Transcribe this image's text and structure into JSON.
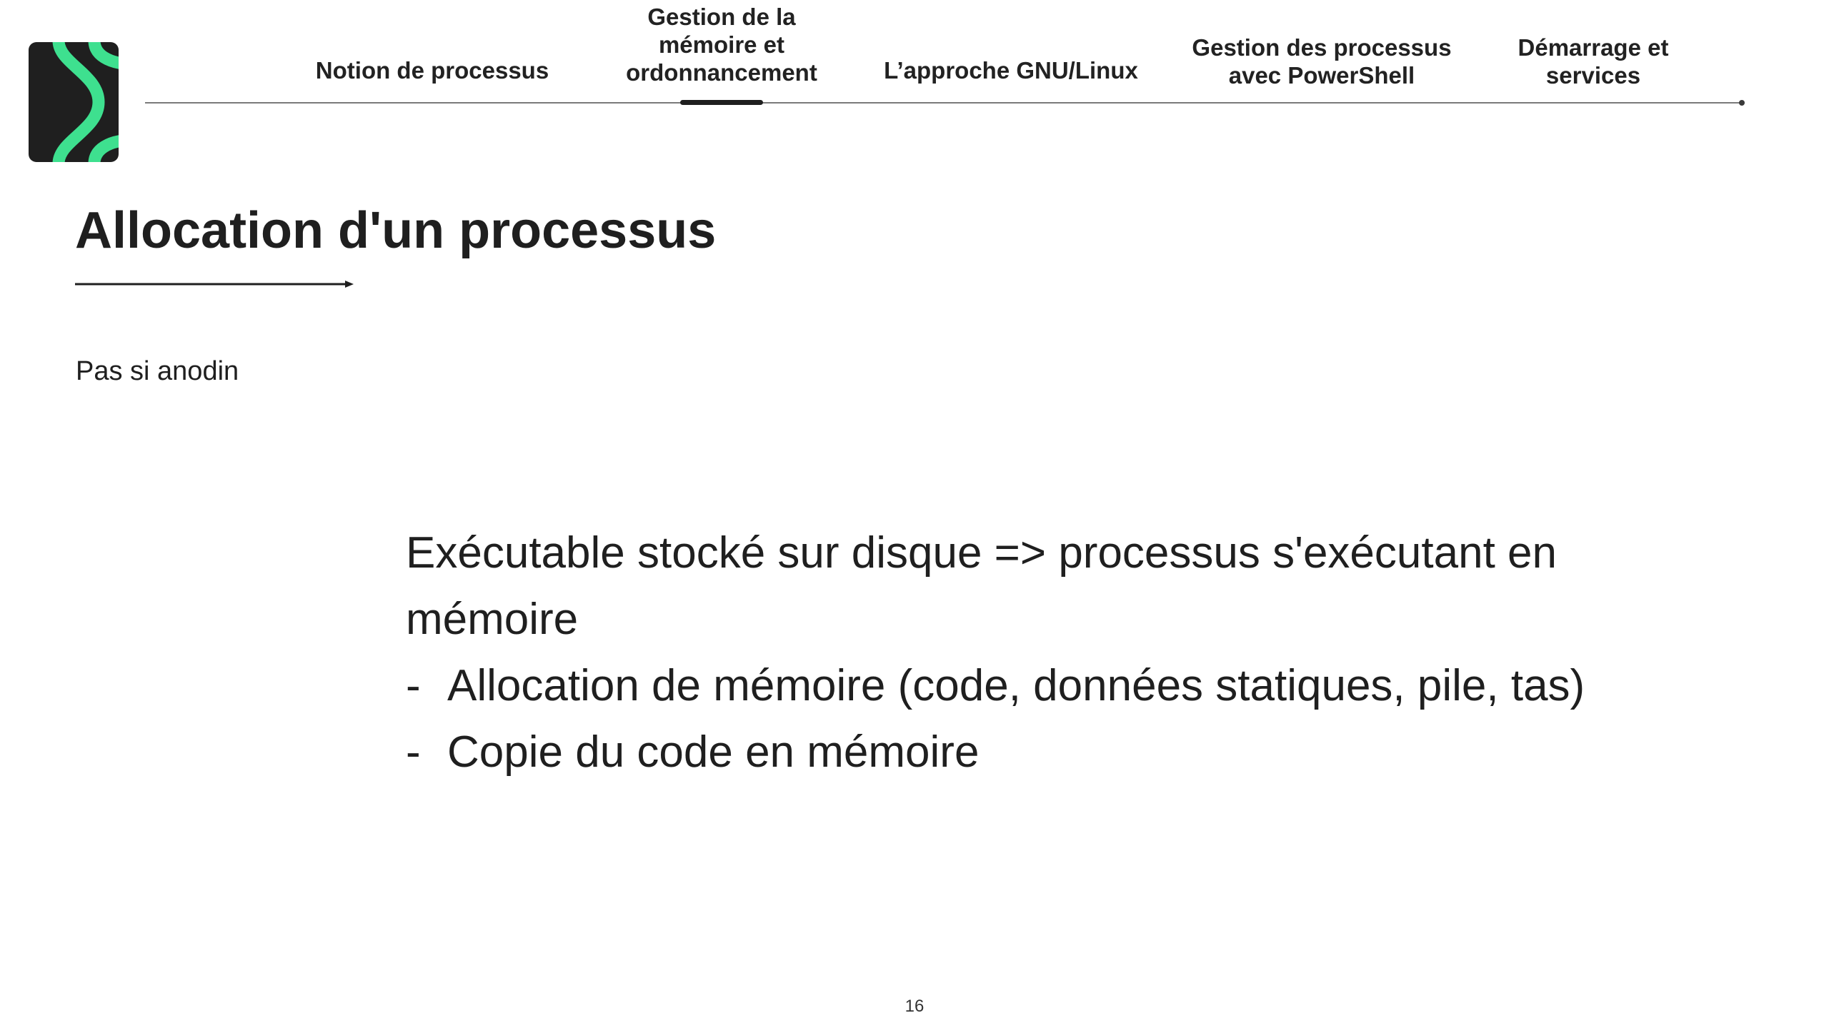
{
  "nav": {
    "items": [
      {
        "label": "Notion de processus"
      },
      {
        "label": "Gestion de la\nmémoire et\nordonnancement"
      },
      {
        "label": "L’approche GNU/Linux"
      },
      {
        "label": "Gestion des processus\navec PowerShell"
      },
      {
        "label": "Démarrage et\nservices"
      }
    ],
    "active_index": 1
  },
  "slide": {
    "title": "Allocation d'un processus",
    "subtitle": "Pas si anodin",
    "lead": "Exécutable stocké sur disque => processus s'exécutant en mémoire",
    "bullets": [
      "Allocation de mémoire (code, données statiques, pile, tas)",
      "Copie du code en mémoire"
    ],
    "bullet_marker": "-",
    "page_number": "16"
  },
  "colors": {
    "logo_background": "#1f1f1f",
    "logo_accent": "#3ee08f",
    "text": "#1f1f1f",
    "nav_line": "#7a7a7a"
  },
  "icons": {
    "logo": "brand-logo-icon",
    "title_underline": "arrow-right-icon"
  }
}
